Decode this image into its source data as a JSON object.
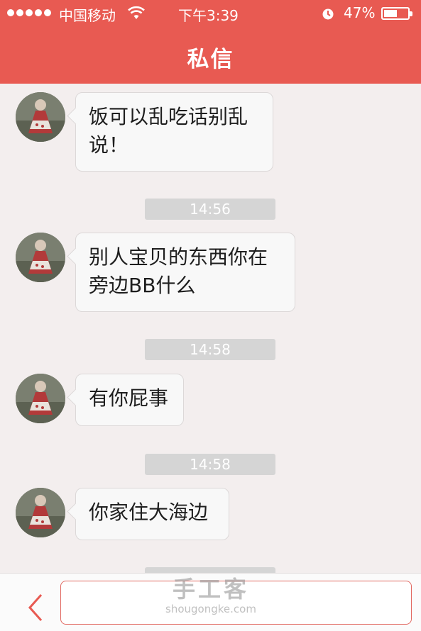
{
  "status_bar": {
    "carrier": "中国移动",
    "time": "下午3:39",
    "battery_percent": "47%"
  },
  "header": {
    "title": "私信"
  },
  "messages": [
    {
      "text": "饭可以乱吃话别乱说！",
      "line1": "饭可以乱吃话别乱",
      "line2": "说！"
    },
    {
      "timestamp": "14:56",
      "line1": "别人宝贝的东西你在",
      "line2": "旁边BB什么"
    },
    {
      "timestamp": "14:58",
      "line1": "有你屁事"
    },
    {
      "timestamp": "14:58",
      "line1": "你家住大海边"
    }
  ],
  "watermark": {
    "main": "手工客",
    "sub": "shougongke.com"
  },
  "colors": {
    "header_bg": "#e85a52",
    "page_bg": "#f3eeee",
    "input_border": "#e26a63"
  },
  "icons": [
    "wifi-icon",
    "alarm-icon",
    "battery-icon",
    "back-chevron-icon"
  ]
}
